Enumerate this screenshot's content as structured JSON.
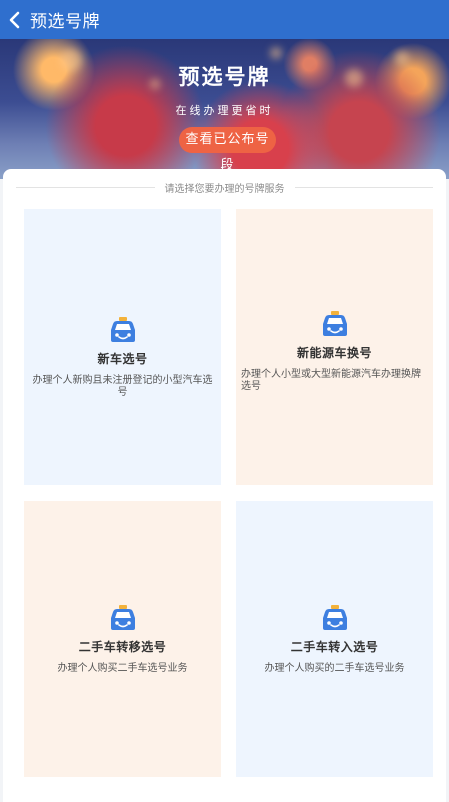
{
  "header": {
    "title": "预选号牌"
  },
  "banner": {
    "title": "预选号牌",
    "subtitle": "在线办理更省时",
    "button_label": "查看已公布号段"
  },
  "section": {
    "prompt": "请选择您要办理的号牌服务"
  },
  "services": [
    {
      "title": "新车选号",
      "desc": "办理个人新购且未注册登记的小型汽车选号",
      "icon": "car-icon"
    },
    {
      "title": "新能源车换号",
      "desc": "办理个人小型或大型新能源汽车办理换牌选号",
      "icon": "car-icon"
    },
    {
      "title": "二手车转移选号",
      "desc": "办理个人购买二手车选号业务",
      "icon": "car-icon"
    },
    {
      "title": "二手车转入选号",
      "desc": "办理个人购买的二手车选号业务",
      "icon": "car-icon"
    }
  ],
  "colors": {
    "header": "#2f6fce",
    "accent_button": "#ee6344",
    "card_blue": "#eef5fe",
    "card_orange": "#fdf2e9",
    "icon_blue": "#3d7fe0",
    "icon_roof": "#f3b23b"
  }
}
